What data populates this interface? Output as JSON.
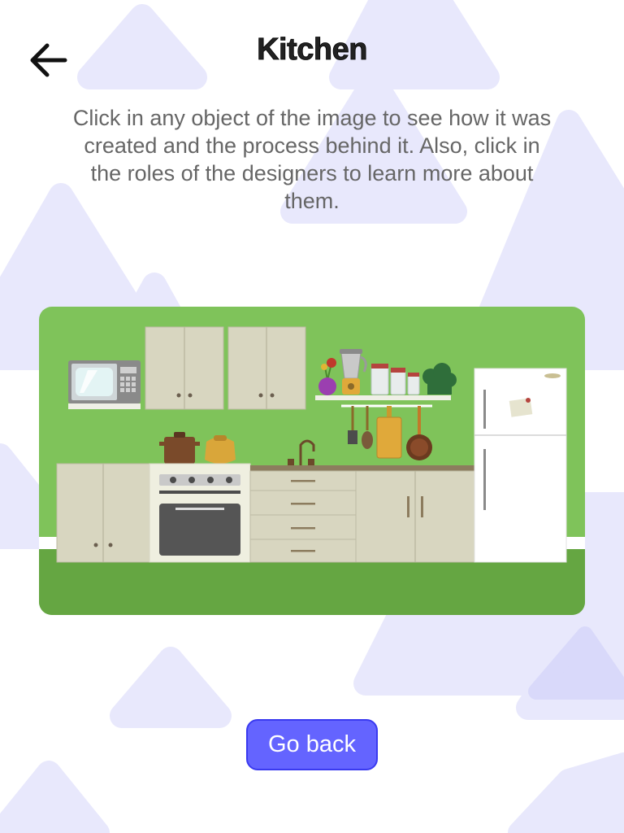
{
  "header": {
    "title": "Kitchen",
    "back_icon": "arrow-left-icon"
  },
  "instructions": "Click in any object of the image to see how it was created and the process behind it. Also, click in the roles of the designers to learn more about them.",
  "illustration": {
    "objects": [
      "microwave",
      "upper-cabinet",
      "plant",
      "blender",
      "jars",
      "cooking-pot",
      "kettle",
      "stove-oven",
      "sink-faucet",
      "drawers",
      "lower-cabinet",
      "hanging-utensils",
      "cutting-board",
      "frying-pan",
      "refrigerator",
      "fridge-note"
    ]
  },
  "buttons": {
    "go_back": "Go back"
  },
  "colors": {
    "accent": "#6464ff",
    "wall": "#7fc35a",
    "floor": "#65a642",
    "background_shapes": "#e6e6fb"
  }
}
